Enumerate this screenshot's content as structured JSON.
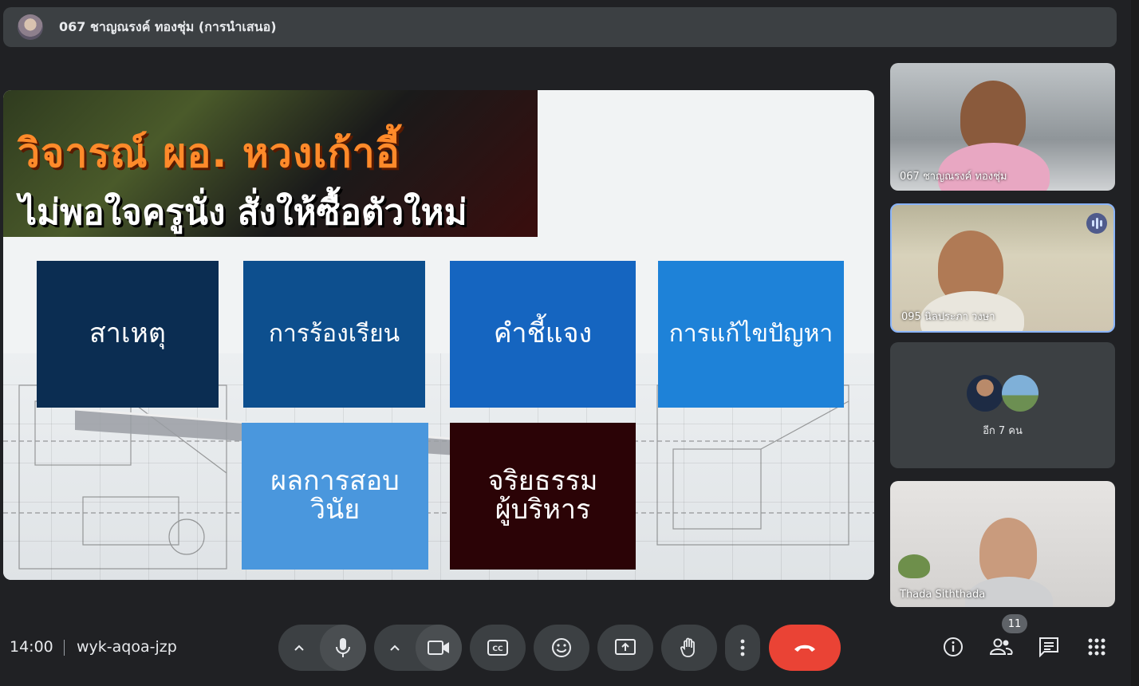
{
  "presenter_bar": {
    "title": "067 ชาญณรงค์ ทองชุ่ม (การนำเสนอ)"
  },
  "slide": {
    "headline_line1": "วิจารณ์ ผอ. หวงเก้าอี้",
    "headline_line2": "ไม่พอใจครูนั่ง สั่งให้ซื้อตัวใหม่",
    "boxes": [
      {
        "label": "สาเหตุ",
        "color": "#0b2d52"
      },
      {
        "label": "การร้องเรียน",
        "color": "#0d4f8e"
      },
      {
        "label": "คำชี้แจง",
        "color": "#1565c0"
      },
      {
        "label": "การแก้ไขปัญหา",
        "color": "#1e82d8"
      },
      {
        "label": "ผลการสอบ\nวินัย",
        "color": "#4a97dd"
      },
      {
        "label": "จริยธรรม\nผู้บริหาร",
        "color": "#2b0306"
      }
    ]
  },
  "participants": [
    {
      "name": "067 ชาญณรงค์ ทองชุ่ม"
    },
    {
      "name": "095 นิลประภา วงษา"
    },
    {
      "more_label": "อีก 7 คน"
    },
    {
      "name": "Thada Siththada"
    }
  ],
  "bottom_bar": {
    "time": "14:00",
    "meeting_code": "wyk-aqoa-jzp",
    "participant_count": "11"
  },
  "colors": {
    "leave": "#ea4335",
    "control_bg": "#3c4043",
    "active_speaker_border": "#8ab4f8"
  }
}
